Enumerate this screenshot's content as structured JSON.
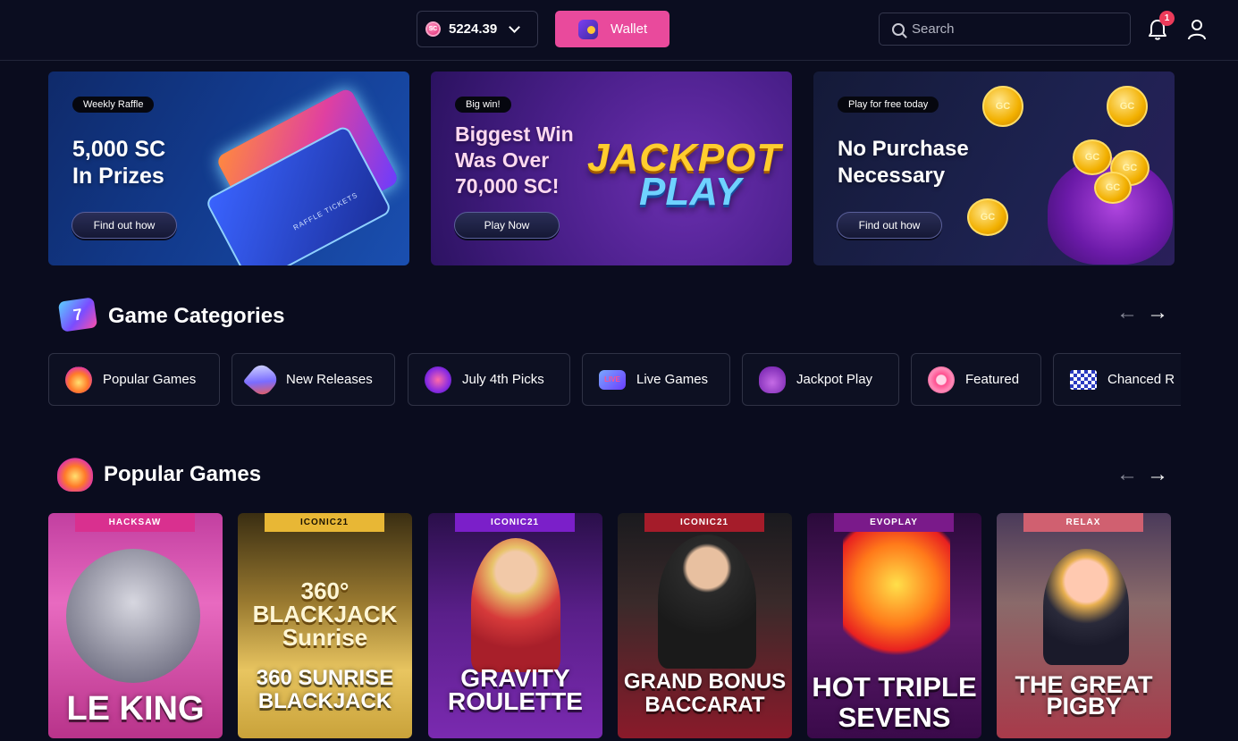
{
  "header": {
    "balance": "5224.39",
    "currency_badge": "SC",
    "wallet_label": "Wallet",
    "search_placeholder": "Search",
    "notification_count": "1"
  },
  "banners": [
    {
      "pill": "Weekly Raffle",
      "title": "5,000 SC\nIn Prizes",
      "button": "Find out how",
      "art_text": "RAFFLE TICKETS"
    },
    {
      "pill": "Big win!",
      "title": "Biggest Win\nWas Over\n70,000 SC!",
      "button": "Play Now",
      "logo_line1": "JACKPOT",
      "logo_line2": "PLAY"
    },
    {
      "pill": "Play for free today",
      "title": "No Purchase\nNecessary",
      "button": "Find out how",
      "coin_label": "GC"
    }
  ],
  "categories": {
    "title": "Game Categories",
    "prev_arrow": "←",
    "next_arrow": "→",
    "items": [
      {
        "label": "Popular Games",
        "icon": "flame-icon"
      },
      {
        "label": "New Releases",
        "icon": "rocket-icon"
      },
      {
        "label": "July 4th Picks",
        "icon": "firework-icon"
      },
      {
        "label": "Live Games",
        "icon": "live-icon"
      },
      {
        "label": "Jackpot Play",
        "icon": "jackpot-bag-icon"
      },
      {
        "label": "Featured",
        "icon": "medal-icon"
      },
      {
        "label": "Chanced R",
        "icon": "race-flag-icon"
      }
    ]
  },
  "popular": {
    "title": "Popular Games",
    "prev_arrow": "←",
    "next_arrow": "→",
    "games": [
      {
        "provider": "HACKSAW",
        "name": "LE KING"
      },
      {
        "provider": "ICONIC21",
        "name": "360 SUNRISE\nBLACKJACK",
        "art_title": "360°\nBLACKJACK\nSunrise"
      },
      {
        "provider": "ICONIC21",
        "name": "GRAVITY\nROULETTE"
      },
      {
        "provider": "ICONIC21",
        "name": "GRAND BONUS\nBACCARAT"
      },
      {
        "provider": "EVOPLAY",
        "name": "HOT TRIPLE\nSEVENS"
      },
      {
        "provider": "RELAX",
        "name": "THE GREAT\nPIGBY"
      }
    ]
  },
  "colors": {
    "background": "#0a0c1e",
    "accent_pink": "#e94a9c",
    "badge_red": "#ec3b5a"
  }
}
